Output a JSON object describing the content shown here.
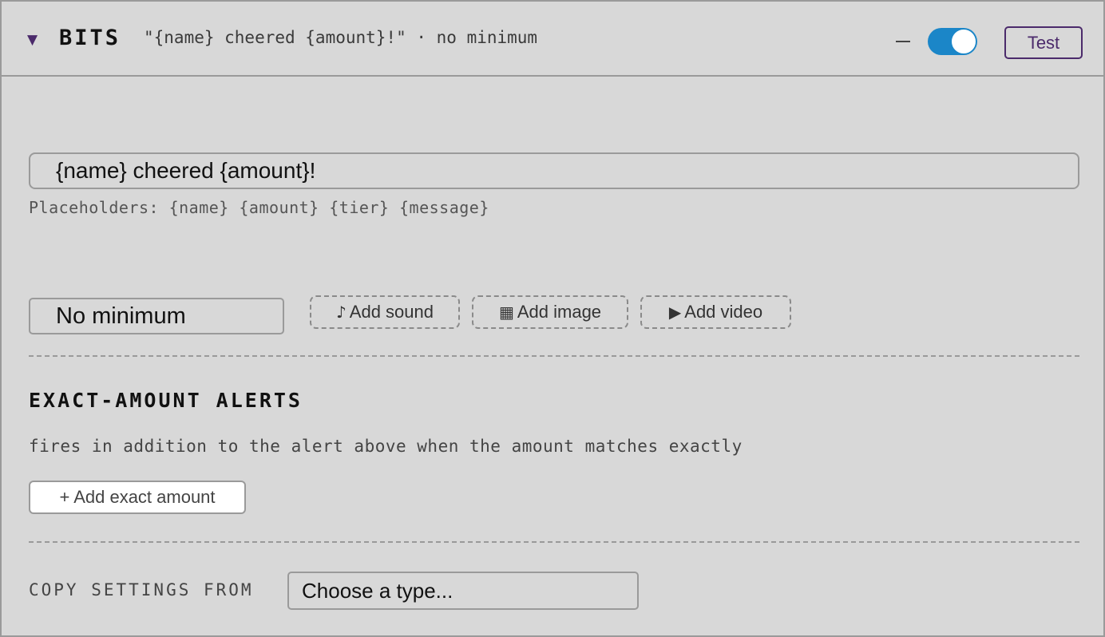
{
  "header": {
    "type_name": "BITS",
    "summary": "\"{name} cheered {amount}!\" · no minimum",
    "test_label": "Test",
    "enabled": true,
    "colors": {
      "accent": "#4b2a6b",
      "toggle_on": "#1b86c8"
    }
  },
  "message": {
    "value": "{name} cheered {amount}!",
    "help": "Placeholders: {name} {amount} {tier} {message}"
  },
  "minimum": {
    "selected": "No minimum"
  },
  "media": {
    "sound_icon": "♪",
    "sound_label": "Add sound",
    "image_icon": "▦",
    "image_label": "Add image",
    "video_icon": "▶",
    "video_label": "Add video"
  },
  "exact": {
    "title": "EXACT-AMOUNT ALERTS",
    "description": "fires in addition to the alert above when the amount matches exactly",
    "add_label": "+ Add exact amount"
  },
  "copy": {
    "label": "COPY SETTINGS FROM",
    "selected": "Choose a type..."
  }
}
